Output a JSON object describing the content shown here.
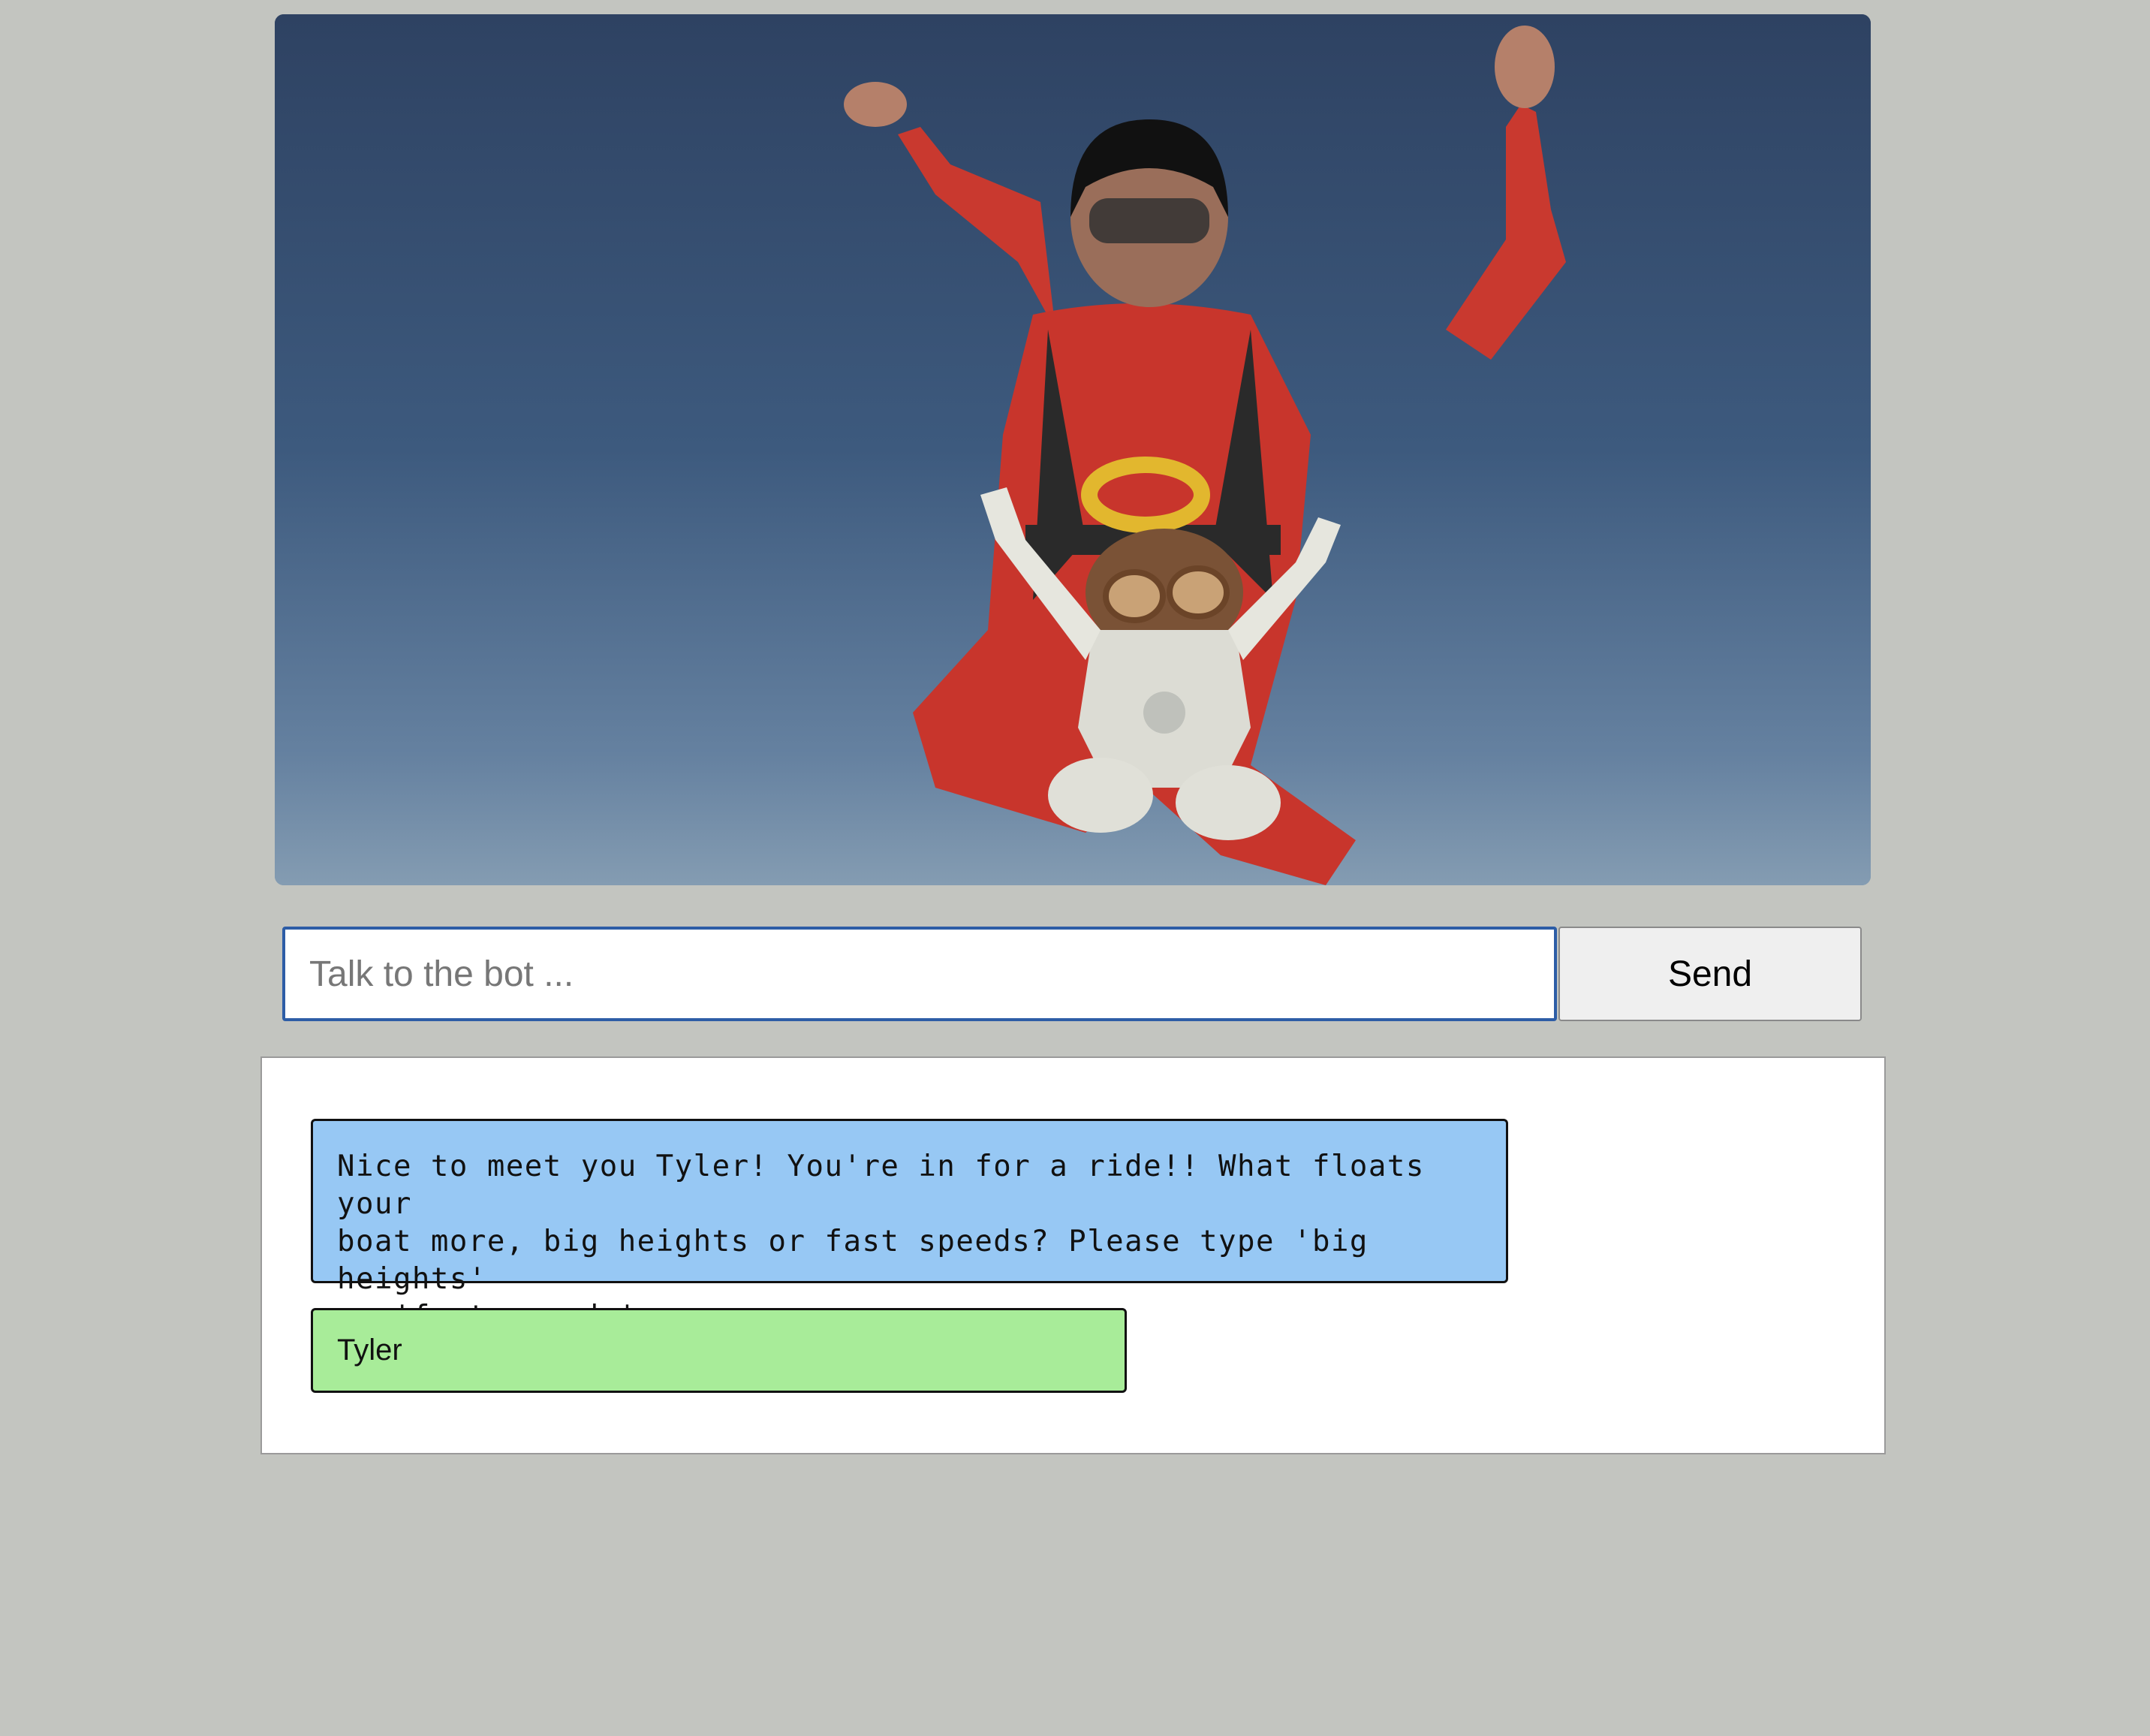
{
  "hero_image": {
    "description_icon": "skydiver-with-robot-photo"
  },
  "input": {
    "placeholder": "Talk to the bot ...",
    "value": ""
  },
  "send_button": {
    "label": "Send"
  },
  "conversation": {
    "messages": [
      {
        "sender": "bot",
        "text": "Nice to meet you Tyler! You're in for a ride!! What floats your\nboat more, big heights or fast speeds? Please type 'big heights'\nor 'fast speeds'.",
        "color": "#97c8f4"
      },
      {
        "sender": "user",
        "text": "Tyler",
        "color": "#a8ec99"
      }
    ]
  },
  "colors": {
    "page_background": "#c3c5c0",
    "input_border": "#2d5da6",
    "bot_bubble": "#97c8f4",
    "user_bubble": "#a8ec99"
  }
}
